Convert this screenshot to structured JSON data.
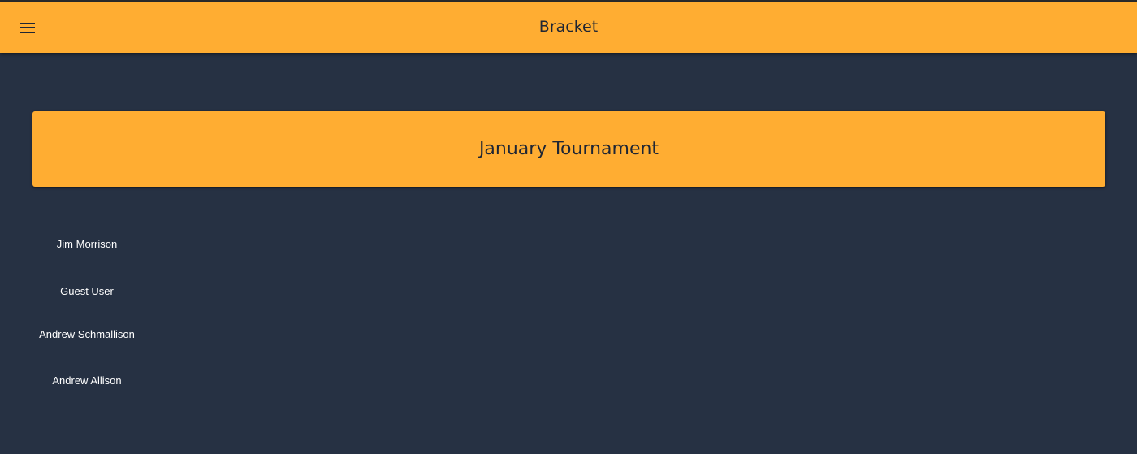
{
  "app_bar": {
    "title": "Bracket",
    "menu_icon": "menu-icon"
  },
  "tournament": {
    "title": "January Tournament"
  },
  "players": [
    "Jim Morrison",
    "Guest User",
    "Andrew Schmallison",
    "Andrew Allison"
  ],
  "colors": {
    "background": "#263143",
    "accent": "#ffad32",
    "text_dark": "#1f2634",
    "text_light": "#ffffff"
  }
}
